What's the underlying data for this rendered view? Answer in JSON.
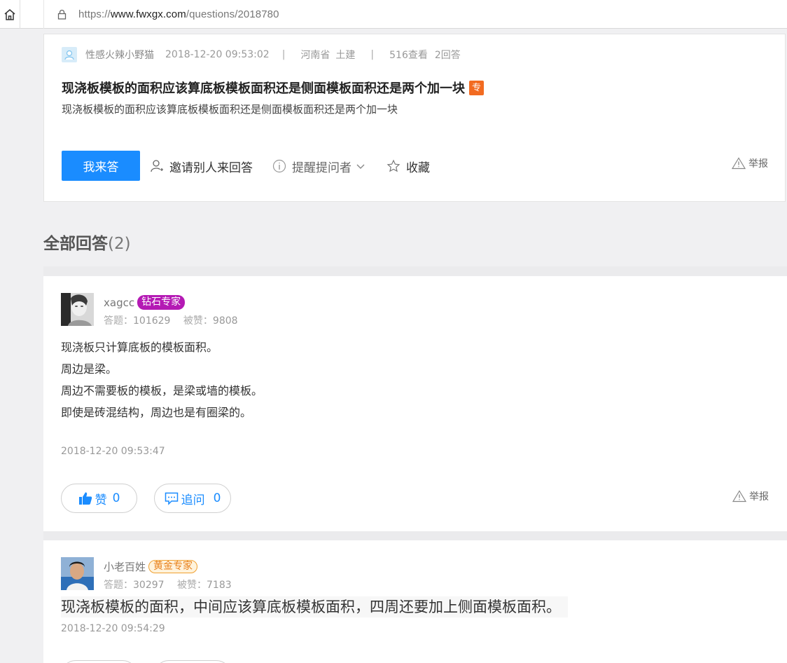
{
  "browser": {
    "url_scheme": "https://",
    "url_host": "www.fwxgx.com",
    "url_path": "/questions/2018780"
  },
  "question": {
    "asker": "性感火辣小野猫",
    "time": "2018-12-20 09:53:02",
    "separator": "|",
    "province": "河南省",
    "category": "土建",
    "views": "516查看",
    "answers": "2回答",
    "title": "现浇板模板的面积应该算底板模板面积还是侧面模板面积还是两个加一块",
    "pro_badge": "专",
    "description": "现浇板模板的面积应该算底板模板面积还是侧面模板面积还是两个加一块",
    "answer_button": "我来答",
    "invite_label": "邀请别人来回答",
    "remind_label": "提醒提问者",
    "favorite_label": "收藏",
    "report_label": "举报"
  },
  "answers_section": {
    "title": "全部回答",
    "count": "(2)"
  },
  "answers": [
    {
      "user": "xagcc",
      "badge": "钻石专家",
      "stats_answers_label": "答题：",
      "stats_answers": "101629",
      "stats_likes_label": "被赞：",
      "stats_likes": "9808",
      "lines": [
        "现浇板只计算底板的模板面积。",
        "周边是梁。",
        "周边不需要板的模板，是梁或墙的模板。",
        "即使是砖混结构，周边也是有圈梁的。"
      ],
      "time": "2018-12-20 09:53:47",
      "like_label": "赞",
      "like_count": "0",
      "followup_label": "追问",
      "followup_count": "0",
      "report_label": "举报"
    },
    {
      "user": "小老百姓",
      "badge": "黄金专家",
      "stats_answers_label": "答题：",
      "stats_answers": "30297",
      "stats_likes_label": "被赞：",
      "stats_likes": "7183",
      "body": "现浇板模板的面积，中间应该算底板模板面积，四周还要加上侧面模板面积。",
      "time": "2018-12-20 09:54:29"
    }
  ],
  "colors": {
    "primary": "#1a8cff",
    "pro_badge": "#f26b21",
    "diamond_badge": "#b41ab4",
    "gold_badge": "#e8801a",
    "background": "#f0f0f2"
  },
  "icons": [
    "home-icon",
    "lock-icon",
    "user-add-icon",
    "info-icon",
    "chevron-down-icon",
    "star-icon",
    "warning-icon",
    "thumbs-up-icon",
    "comment-icon"
  ]
}
